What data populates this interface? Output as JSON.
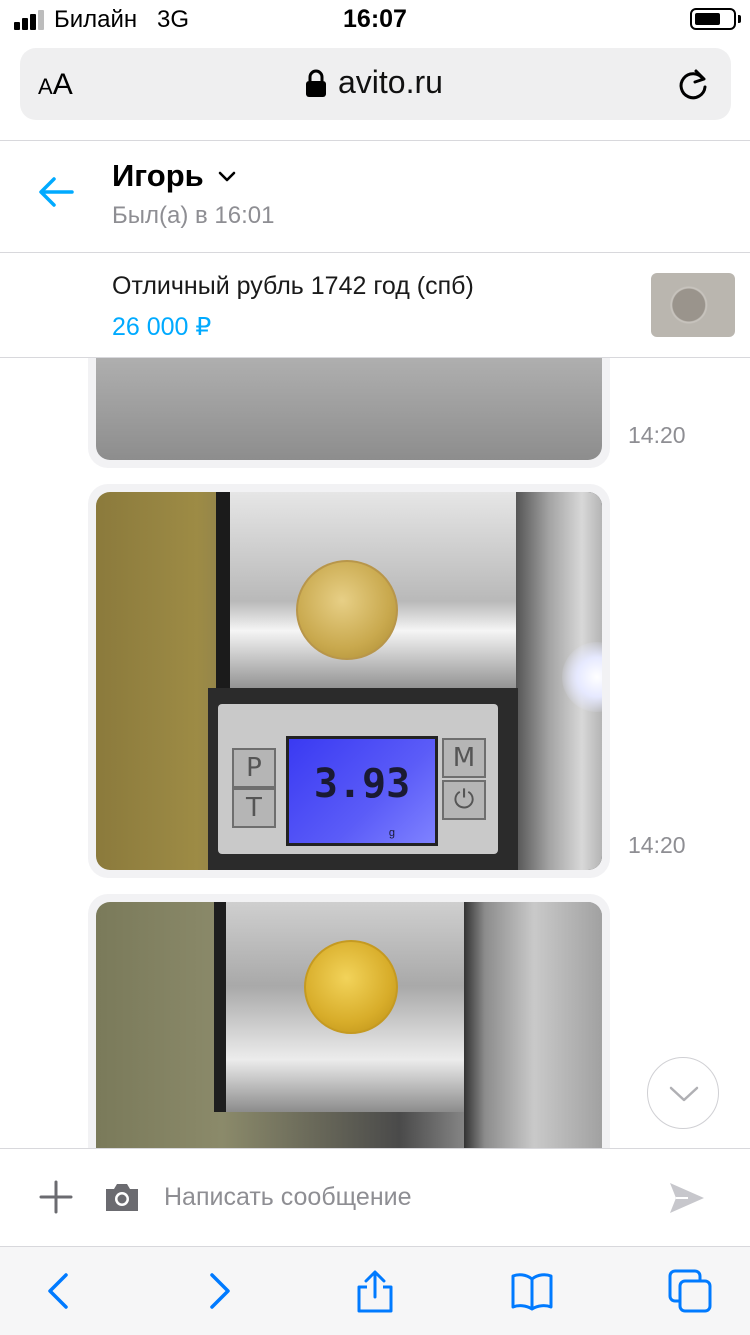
{
  "status_bar": {
    "carrier": "Билайн",
    "network": "3G",
    "time": "16:07",
    "battery_level": 0.7,
    "signal_bars": 3
  },
  "browser": {
    "text_size_small": "A",
    "text_size_large": "A",
    "url": "avito.ru",
    "icons": [
      "lock-icon",
      "reload-icon"
    ]
  },
  "chat_header": {
    "contact_name": "Игорь",
    "contact_status": "Был(а) в 16:01",
    "icons": [
      "back-arrow-icon",
      "chevron-down-icon"
    ]
  },
  "listing": {
    "title": "Отличный рубль 1742 год (спб)",
    "price": "26 000 ₽"
  },
  "messages": [
    {
      "type": "photo",
      "time": "14:20"
    },
    {
      "type": "photo",
      "time": "14:20",
      "photo_text": {
        "scale_reading": "3.93",
        "unit": "g",
        "keys": [
          "P",
          "T",
          "M",
          "⏻"
        ]
      }
    },
    {
      "type": "photo",
      "time": ""
    }
  ],
  "composer": {
    "placeholder": "Написать сообщение",
    "value": "",
    "icons": [
      "plus-icon",
      "camera-icon",
      "send-icon"
    ]
  },
  "toolbar": {
    "icons": [
      "back-icon",
      "forward-icon",
      "share-icon",
      "bookmarks-icon",
      "tabs-icon"
    ]
  },
  "colors": {
    "accent": "#00aaff",
    "muted": "#8e8e93",
    "bubble": "#f2f2f4",
    "ios_blue": "#007aff"
  }
}
